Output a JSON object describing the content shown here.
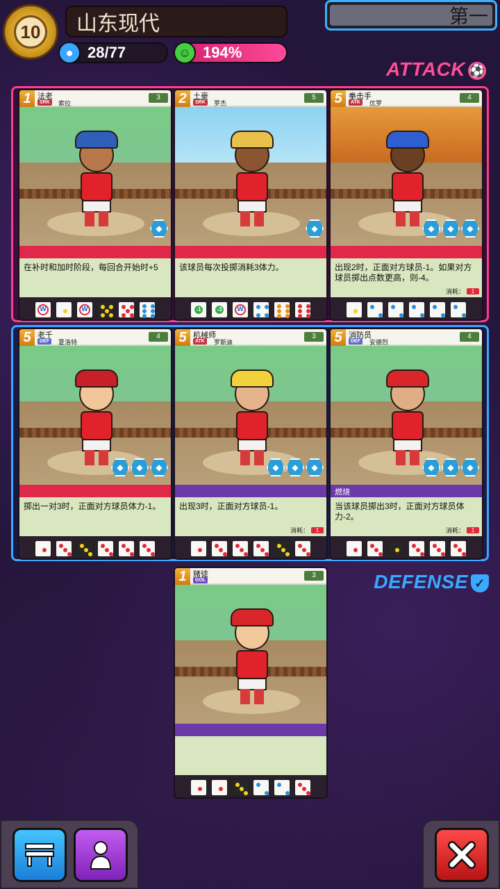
{
  "header": {
    "level": "10",
    "team_name": "山东现代",
    "rank": "第一",
    "members": "28/77",
    "morale": "194%"
  },
  "labels": {
    "attack": "ATTACK",
    "defense": "DEFENSE"
  },
  "icons": {
    "level": "laurel-badge-icon",
    "members": "team-members-icon",
    "morale": "smiley-morale-icon",
    "attack": "soccer-ball-icon",
    "defense": "shield-icon",
    "bench": "bench-icon",
    "player": "player-silhouette-icon",
    "close": "close-x-icon"
  },
  "colors": {
    "attack": "#ff3d8a",
    "defense": "#3fa7ff",
    "morale_bar": "#e02a7a",
    "close_button": "#e02020"
  },
  "cards": [
    {
      "id": "c1",
      "cost": "1",
      "title": "法老",
      "position": "SRK",
      "player": "索拉",
      "stamina": "3",
      "band_text": "",
      "desc": "在补时和加时阶段，每回合开始时+5",
      "cost_label": "",
      "dice": [
        "w",
        "pip1-yellow",
        "w",
        "black-pip5",
        "pip5-red",
        "pip6-blue"
      ]
    },
    {
      "id": "c2",
      "cost": "2",
      "title": "土豪",
      "position": "SRK",
      "player": "罗杰",
      "stamina": "5",
      "band_text": "",
      "desc": "该球员每次投掷消耗3体力。",
      "cost_label": "",
      "dice": [
        "g1",
        "g3",
        "w",
        "pip4-blue",
        "pip6-orange",
        "pip6-red"
      ]
    },
    {
      "id": "c3",
      "cost": "5",
      "title": "拳击手",
      "position": "ATK",
      "player": "优罗",
      "stamina": "4",
      "band_text": "",
      "desc": "出现2时，正面对方球员-1。如果对方球员掷出点数更高，则-4。",
      "cost_label": "消耗：",
      "dice": [
        "pip1-yellow",
        "pip2-blue",
        "pip2-blue",
        "pip2-blue",
        "pip2-blue",
        "pip2-blue"
      ]
    },
    {
      "id": "c4",
      "cost": "5",
      "title": "老千",
      "position": "DEF",
      "player": "夏洛特",
      "stamina": "4",
      "band_text": "",
      "desc": "掷出一对3时，正面对方球员体力-1。",
      "cost_label": "",
      "dice": [
        "pip1-red",
        "pip3-red",
        "black-pip3",
        "pip3-red",
        "pip3-red",
        "pip3-red"
      ]
    },
    {
      "id": "c5",
      "cost": "5",
      "title": "机械师",
      "position": "ATK",
      "player": "罗斯迪",
      "stamina": "3",
      "band_text": "",
      "desc": "出现3时，正面对方球员-1。",
      "cost_label": "消耗：",
      "dice": [
        "pip1-red",
        "pip3-red",
        "pip3-red",
        "pip3-red",
        "black-pip3",
        "pip3-red"
      ]
    },
    {
      "id": "c6",
      "cost": "5",
      "title": "消防员",
      "position": "DEF",
      "player": "安德烈",
      "stamina": "4",
      "band_text": "燃烧",
      "desc": "当该球员掷出3时，正面对方球员体力-2。",
      "cost_label": "消耗：",
      "dice": [
        "pip1-red",
        "pip3-red",
        "black-pip1",
        "pip3-red",
        "pip3-red",
        "pip3-red"
      ]
    },
    {
      "id": "c7",
      "cost": "1",
      "title": "赌徒",
      "position": "GOL",
      "player": "",
      "stamina": "3",
      "band_text": "",
      "desc": "",
      "cost_label": "",
      "dice": [
        "pip1-red",
        "pip1-red",
        "black-pip3",
        "pip2-blue",
        "pip2-blue",
        "pip3-red"
      ]
    }
  ]
}
